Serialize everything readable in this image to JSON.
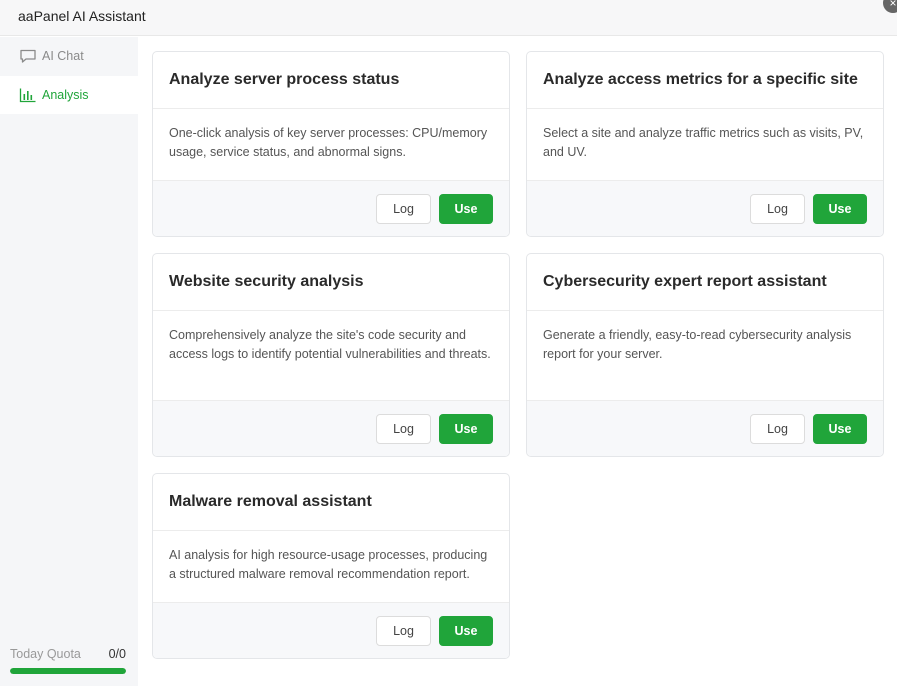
{
  "app": {
    "title": "aaPanel AI Assistant"
  },
  "sidebar": {
    "items": [
      {
        "label": "AI Chat",
        "icon": "chat-bubble-icon",
        "active": false
      },
      {
        "label": "Analysis",
        "icon": "bar-chart-icon",
        "active": true
      }
    ],
    "quota": {
      "label": "Today Quota",
      "value": "0/0",
      "fill_fraction": 1.0
    }
  },
  "cards": [
    {
      "title": "Analyze server process status",
      "description": "One-click analysis of key server processes: CPU/memory usage, service status, and abnormal signs.",
      "log_label": "Log",
      "use_label": "Use"
    },
    {
      "title": "Analyze access metrics for a specific site",
      "description": "Select a site and analyze traffic metrics such as visits, PV, and UV.",
      "log_label": "Log",
      "use_label": "Use"
    },
    {
      "title": "Website security analysis",
      "description": "Comprehensively analyze the site's code security and access logs to identify potential vulnerabilities and threats.",
      "log_label": "Log",
      "use_label": "Use"
    },
    {
      "title": "Cybersecurity expert report assistant",
      "description": "Generate a friendly, easy-to-read cybersecurity analysis report for your server.",
      "log_label": "Log",
      "use_label": "Use"
    },
    {
      "title": "Malware removal assistant",
      "description": "AI analysis for high resource-usage processes, producing a structured malware removal recommendation report.",
      "log_label": "Log",
      "use_label": "Use"
    }
  ],
  "colors": {
    "accent": "#20a53a",
    "sidebar_bg": "#f5f6f8"
  }
}
